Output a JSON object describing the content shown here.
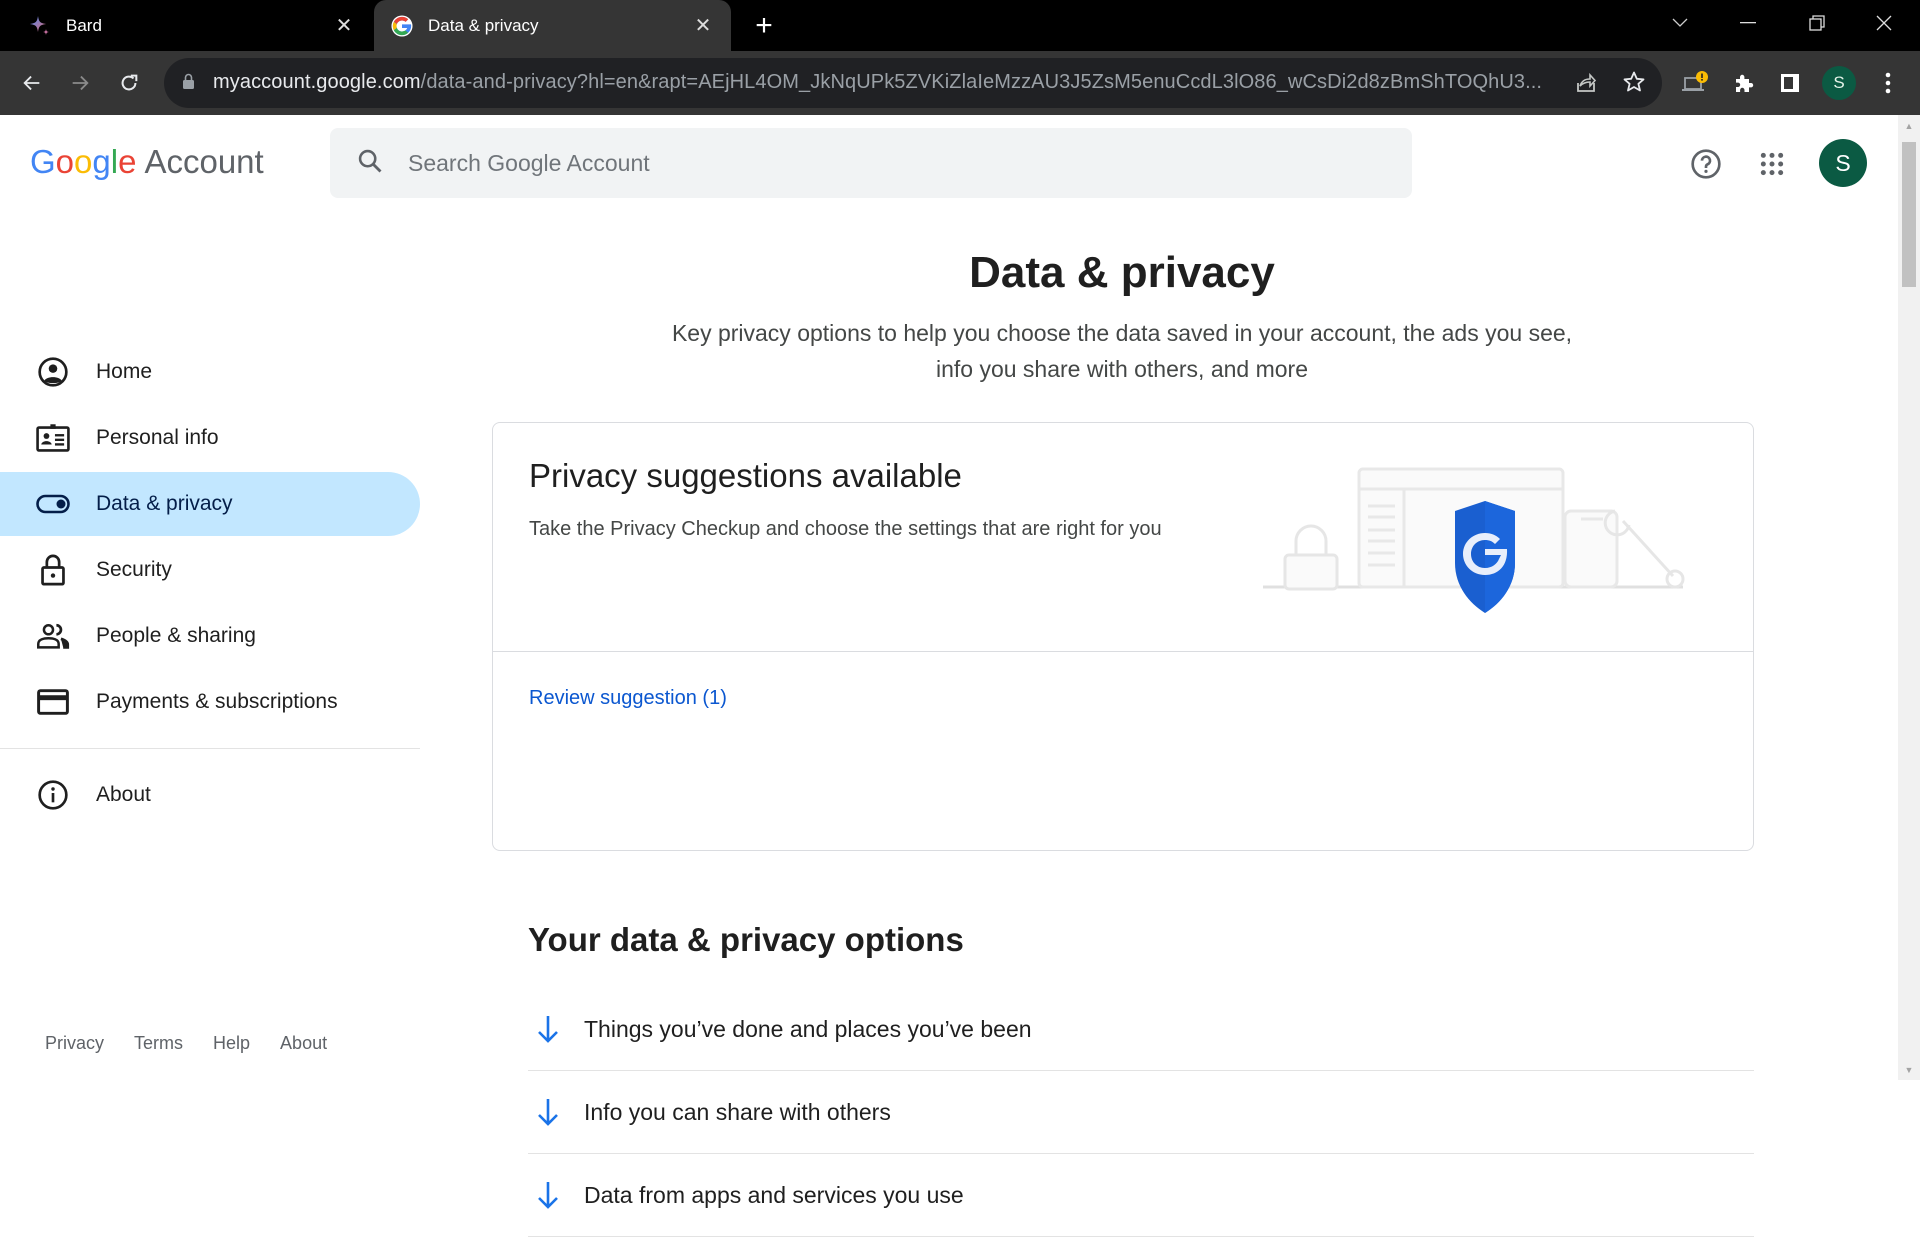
{
  "browser": {
    "tabs": [
      {
        "title": "Bard",
        "icon": "bard-sparkle-icon",
        "active": false
      },
      {
        "title": "Data & privacy",
        "icon": "google-g-icon",
        "active": true
      }
    ],
    "url_host": "myaccount.google.com",
    "url_rest": "/data-and-privacy?hl=en&rapt=AEjHL4OM_JkNqUPk5ZVKiZlaIeMzzAU3J5ZsM5enuCcdL3lO86_wCsDi2d8zBmShTOQhU3...",
    "profile_initial": "S"
  },
  "header": {
    "logo_letters": [
      "G",
      "o",
      "o",
      "g",
      "l",
      "e"
    ],
    "logo_suffix": "Account",
    "search_placeholder": "Search Google Account",
    "avatar_initial": "S"
  },
  "sidebar": {
    "items": [
      {
        "label": "Home",
        "icon": "home-account-icon"
      },
      {
        "label": "Personal info",
        "icon": "id-card-icon"
      },
      {
        "label": "Data & privacy",
        "icon": "toggle-icon",
        "active": true
      },
      {
        "label": "Security",
        "icon": "lock-icon"
      },
      {
        "label": "People & sharing",
        "icon": "people-icon"
      },
      {
        "label": "Payments & subscriptions",
        "icon": "credit-card-icon"
      }
    ],
    "about": {
      "label": "About",
      "icon": "info-icon"
    },
    "footer": [
      "Privacy",
      "Terms",
      "Help",
      "About"
    ]
  },
  "main": {
    "title": "Data & privacy",
    "subtitle": "Key privacy options to help you choose the data saved in your account, the ads you see, info you share with others, and more",
    "card": {
      "title": "Privacy suggestions available",
      "description": "Take the Privacy Checkup and choose the settings that are right for you",
      "link": "Review suggestion (1)"
    },
    "section_title": "Your data & privacy options",
    "options": [
      "Things you’ve done and places you’ve been",
      "Info you can share with others",
      "Data from apps and services you use"
    ]
  },
  "colors": {
    "accent": "#0b57d0",
    "active_nav": "#c2e7ff",
    "avatar": "#0b5a43",
    "shield": "#1a5fd0"
  }
}
